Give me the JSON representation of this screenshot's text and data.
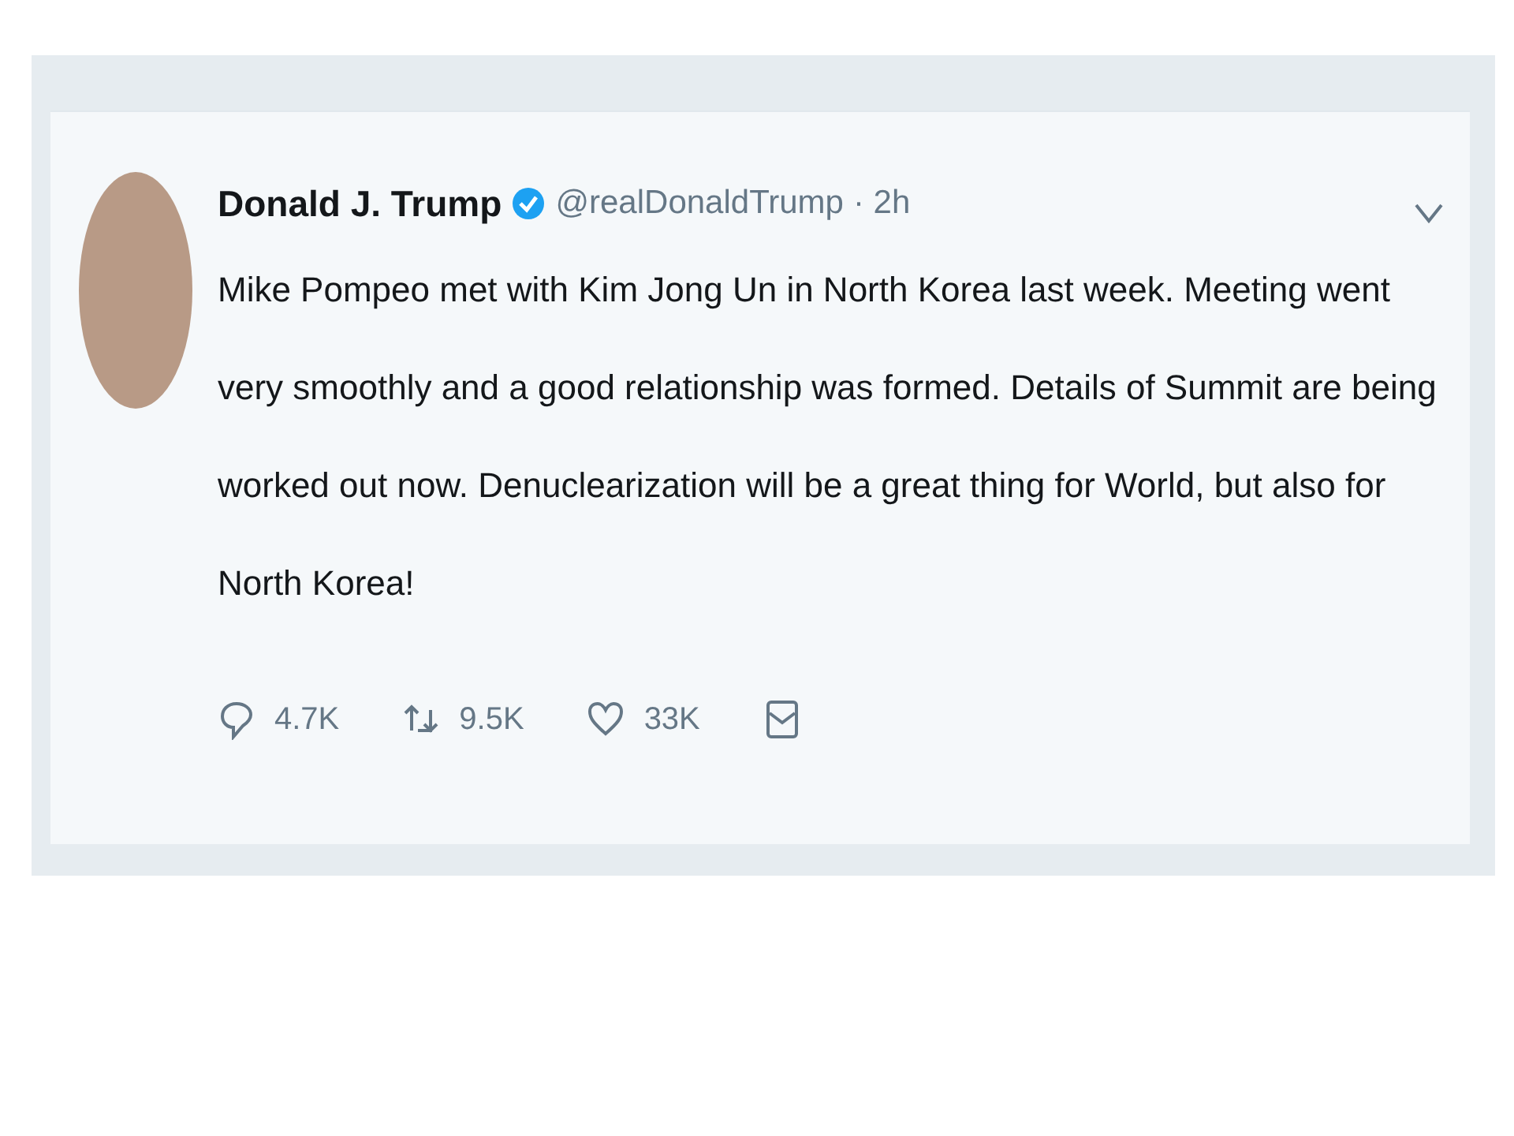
{
  "tweet": {
    "author": "Donald J. Trump",
    "verified": true,
    "handle": "@realDonaldTrump",
    "time": "· 2h",
    "text": "Mike Pompeo met with Kim Jong Un in North Korea last week. Meeting went very smoothly and a good relationship was formed. Details of Summit are being worked out now. Denuclearization will be a great thing for World, but also for North Korea!",
    "actions": [
      {
        "kind": "reply",
        "count": "4.7K"
      },
      {
        "kind": "retweet",
        "count": "9.5K"
      },
      {
        "kind": "like",
        "count": "33K"
      },
      {
        "kind": "message"
      }
    ]
  }
}
